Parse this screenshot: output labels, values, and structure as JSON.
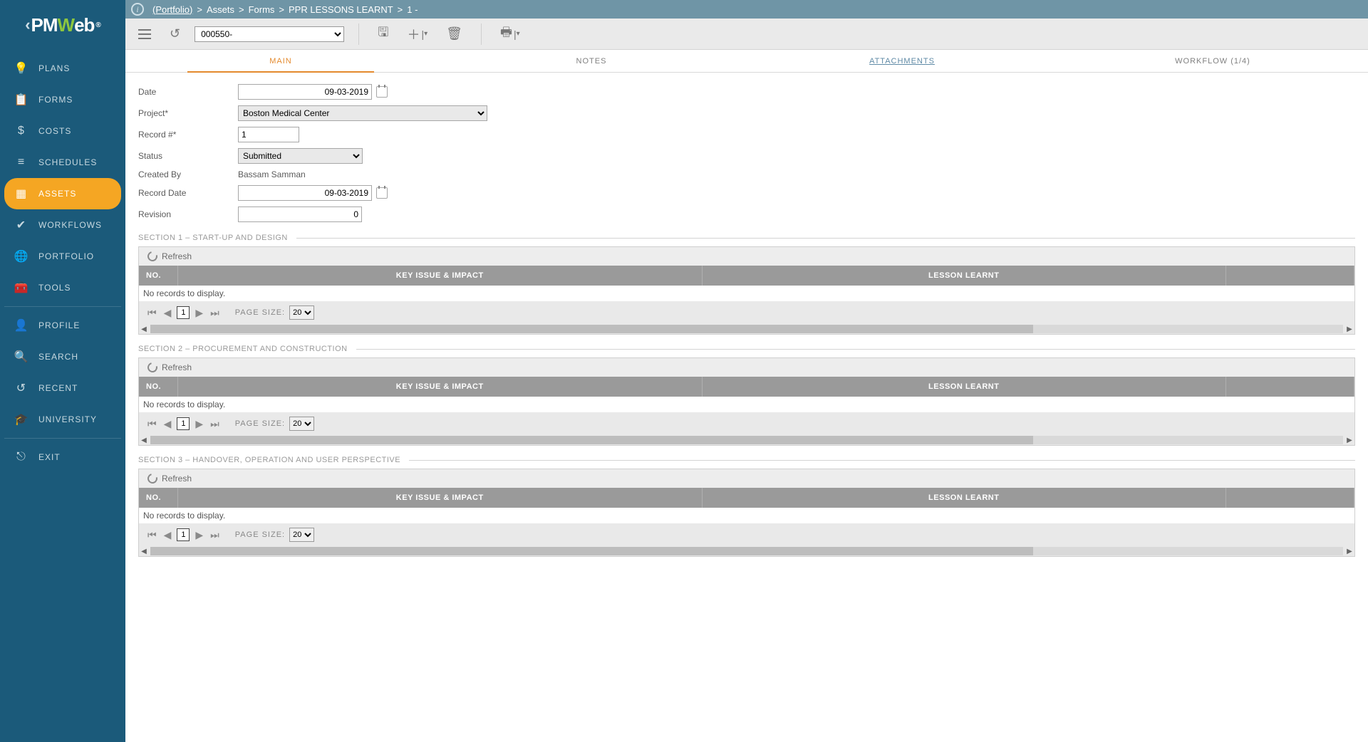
{
  "logo": {
    "prefix": "PM",
    "w": "W",
    "suffix": "eb"
  },
  "breadcrumb": {
    "root": "(Portfolio)",
    "items": [
      "Assets",
      "Forms",
      "PPR LESSONS LEARNT",
      "1 -"
    ]
  },
  "toolbar": {
    "record_dropdown": "000550-"
  },
  "sidebar": {
    "groups": [
      [
        {
          "icon": "💡",
          "label": "PLANS"
        },
        {
          "icon": "📋",
          "label": "FORMS"
        },
        {
          "icon": "$",
          "label": "COSTS"
        },
        {
          "icon": "≡",
          "label": "SCHEDULES"
        },
        {
          "icon": "▦",
          "label": "ASSETS",
          "active": true
        },
        {
          "icon": "✔",
          "label": "WORKFLOWS"
        },
        {
          "icon": "🌐",
          "label": "PORTFOLIO"
        },
        {
          "icon": "🧰",
          "label": "TOOLS"
        }
      ],
      [
        {
          "icon": "👤",
          "label": "PROFILE"
        },
        {
          "icon": "🔍",
          "label": "SEARCH"
        },
        {
          "icon": "↺",
          "label": "RECENT"
        },
        {
          "icon": "🎓",
          "label": "UNIVERSITY"
        }
      ],
      [
        {
          "icon": "⎋",
          "label": "EXIT"
        }
      ]
    ]
  },
  "tabs": [
    {
      "label": "MAIN",
      "state": "active"
    },
    {
      "label": "NOTES",
      "state": ""
    },
    {
      "label": "ATTACHMENTS",
      "state": "link"
    },
    {
      "label": "WORKFLOW (1/4)",
      "state": ""
    }
  ],
  "form": {
    "date_label": "Date",
    "date_value": "09-03-2019",
    "project_label": "Project*",
    "project_value": "Boston Medical Center",
    "record_label": "Record #*",
    "record_value": "1",
    "status_label": "Status",
    "status_value": "Submitted",
    "createdby_label": "Created By",
    "createdby_value": "Bassam Samman",
    "recorddate_label": "Record Date",
    "recorddate_value": "09-03-2019",
    "revision_label": "Revision",
    "revision_value": "0"
  },
  "sections": [
    {
      "title": "SECTION 1 – START-UP AND DESIGN"
    },
    {
      "title": "SECTION 2 – PROCUREMENT AND CONSTRUCTION"
    },
    {
      "title": "SECTION 3 – HANDOVER, OPERATION AND USER PERSPECTIVE"
    }
  ],
  "grid": {
    "refresh": "Refresh",
    "col_no": "NO.",
    "col_key": "KEY ISSUE & IMPACT",
    "col_lesson": "LESSON LEARNT",
    "empty": "No records to display.",
    "page_value": "1",
    "page_size_label": "PAGE SIZE:",
    "page_size_value": "20"
  }
}
